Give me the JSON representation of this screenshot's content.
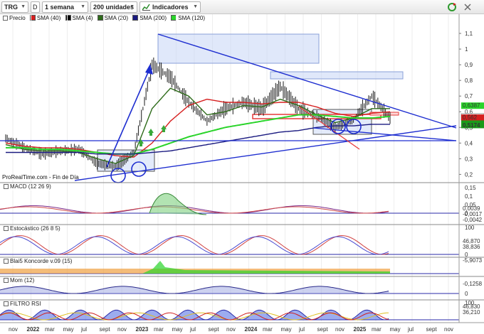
{
  "toolbar": {
    "symbol": "TRG",
    "d_button": "D",
    "period": "1 semana",
    "units": "200 unidades",
    "indicators": "Indicadores"
  },
  "legend": {
    "items": [
      {
        "label": "Precio",
        "color": "#1a1a1a"
      },
      {
        "label": "SMA (40)",
        "color": "#d61f1f"
      },
      {
        "label": "SMA (4)",
        "color": "#000000"
      },
      {
        "label": "SMA (20)",
        "color": "#2e6b1a"
      },
      {
        "label": "SMA (200)",
        "color": "#1a1a80"
      },
      {
        "label": "SMA (120)",
        "color": "#2ad42a"
      }
    ]
  },
  "watermark": "ProRealTime.com - Fin de Día",
  "price_axis": {
    "ticks": [
      "1,1",
      "1",
      "0,9",
      "0,8",
      "0,7",
      "0,6",
      "0,5",
      "0,4",
      "0,3",
      "0,2"
    ],
    "tags": [
      {
        "text": "0,6387",
        "color": "#2ad42a"
      },
      {
        "text": "0,5674",
        "color": "#ffffff"
      },
      {
        "text": "0,562",
        "color": "#d61f1f"
      },
      {
        "text": "0,5174",
        "color": "#1a9a1a"
      }
    ]
  },
  "panels": {
    "macd": {
      "title": "MACD (12 26 9)",
      "ticks": [
        "0,15",
        "0,1",
        "0,05",
        "0"
      ],
      "tags": [
        "0,0039",
        "-0,0017",
        "-0,0042"
      ]
    },
    "stoch": {
      "title": "Estocástico (26 8 5)",
      "ticks": [
        "100",
        "0"
      ],
      "tags": [
        "46,870",
        "38,836"
      ]
    },
    "blai5": {
      "title": "Blai5 Koncorde v.09 (15)",
      "ticks": [],
      "tags": [
        "-5,9073"
      ]
    },
    "mom": {
      "title": "Mom (12)",
      "ticks": [
        "0"
      ],
      "tags": [
        "-0,1258"
      ]
    },
    "rsi": {
      "title": "FILTRO RSI",
      "ticks": [
        "100"
      ],
      "tags": [
        "46,830",
        "36,210"
      ]
    }
  },
  "time_axis": {
    "labels": [
      "nov",
      "2022",
      "mar",
      "may",
      "jul",
      "sept",
      "nov",
      "2023",
      "mar",
      "may",
      "jul",
      "sept",
      "nov",
      "2024",
      "mar",
      "may",
      "jul",
      "sept",
      "nov",
      "2025",
      "mar",
      "may",
      "jul",
      "sept",
      "nov"
    ],
    "bold": [
      "2022",
      "2023",
      "2024",
      "2025"
    ]
  },
  "colors": {
    "price": "#1a1a1a",
    "sma40": "#d61f1f",
    "sma20": "#2e6b1a",
    "sma120": "#2ad42a",
    "trend": "#1e2ed0",
    "box": "#c7d6f5",
    "red_band": "#e63a3a",
    "up_arrow": "#3aa83a"
  },
  "chart_data": {
    "type": "line",
    "title": "TRG",
    "xlabel": "",
    "ylabel": "",
    "ylim": [
      0.17,
      1.15
    ],
    "x": [
      "2021-11",
      "2022-01",
      "2022-03",
      "2022-05",
      "2022-07",
      "2022-09",
      "2022-11",
      "2023-01",
      "2023-03",
      "2023-05",
      "2023-07",
      "2023-09",
      "2023-11",
      "2024-01",
      "2024-03",
      "2024-05",
      "2024-07",
      "2024-09",
      "2024-11",
      "2025-01",
      "2025-03",
      "2025-05"
    ],
    "series": [
      {
        "name": "Precio",
        "values": [
          0.43,
          0.37,
          0.33,
          0.35,
          0.36,
          0.27,
          0.25,
          0.34,
          0.9,
          0.82,
          0.66,
          0.54,
          0.62,
          0.66,
          0.62,
          0.76,
          0.62,
          0.57,
          0.5,
          0.55,
          0.7,
          0.56
        ]
      },
      {
        "name": "SMA (40)",
        "values": [
          0.4,
          0.38,
          0.37,
          0.37,
          0.36,
          0.34,
          0.32,
          0.31,
          0.4,
          0.54,
          0.64,
          0.68,
          0.66,
          0.66,
          0.65,
          0.66,
          0.66,
          0.63,
          0.59,
          0.57,
          0.59,
          0.6
        ]
      },
      {
        "name": "SMA (20)",
        "values": [
          0.39,
          0.36,
          0.35,
          0.35,
          0.34,
          0.3,
          0.27,
          0.32,
          0.62,
          0.75,
          0.7,
          0.58,
          0.6,
          0.64,
          0.63,
          0.68,
          0.64,
          0.58,
          0.53,
          0.56,
          0.62,
          0.62
        ]
      },
      {
        "name": "SMA (120)",
        "values": [
          0.37,
          0.37,
          0.36,
          0.36,
          0.35,
          0.34,
          0.33,
          0.33,
          0.36,
          0.4,
          0.44,
          0.47,
          0.5,
          0.52,
          0.54,
          0.56,
          0.58,
          0.58,
          0.57,
          0.56,
          0.56,
          0.57
        ]
      },
      {
        "name": "SMA (200)",
        "values": [
          0.34,
          0.34,
          0.34,
          0.34,
          0.34,
          0.33,
          0.33,
          0.33,
          0.34,
          0.35,
          0.37,
          0.39,
          0.41,
          0.43,
          0.45,
          0.47,
          0.48,
          0.5,
          0.51,
          0.51,
          0.52,
          0.52
        ]
      }
    ]
  }
}
